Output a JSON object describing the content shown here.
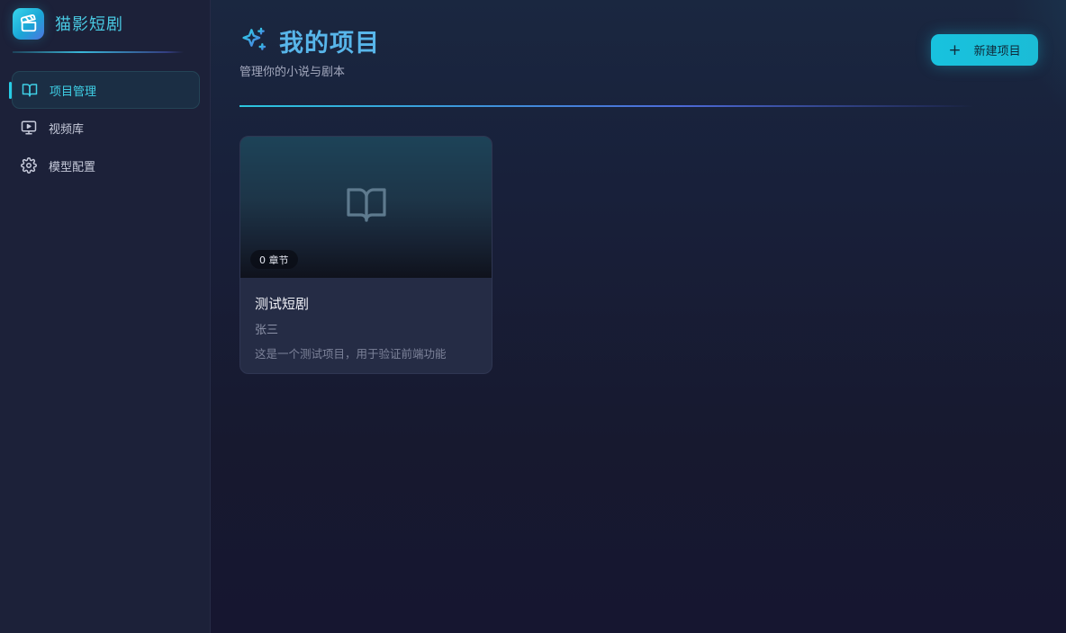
{
  "sidebar": {
    "brand": "猫影短剧",
    "items": [
      {
        "label": "项目管理",
        "icon": "book-open-icon",
        "active": true
      },
      {
        "label": "视频库",
        "icon": "monitor-play-icon",
        "active": false
      },
      {
        "label": "模型配置",
        "icon": "gear-icon",
        "active": false
      }
    ]
  },
  "header": {
    "title": "我的项目",
    "subtitle": "管理你的小说与剧本",
    "new_button": "新建项目"
  },
  "projects": [
    {
      "chapters": "0 章节",
      "title": "测试短剧",
      "author": "张三",
      "description": "这是一个测试项目，用于验证前端功能"
    }
  ],
  "colors": {
    "accent": "#27cde6",
    "title": "#58b6ea",
    "sidebar_bg": "#1c2139",
    "main_bg": "#16172f"
  }
}
